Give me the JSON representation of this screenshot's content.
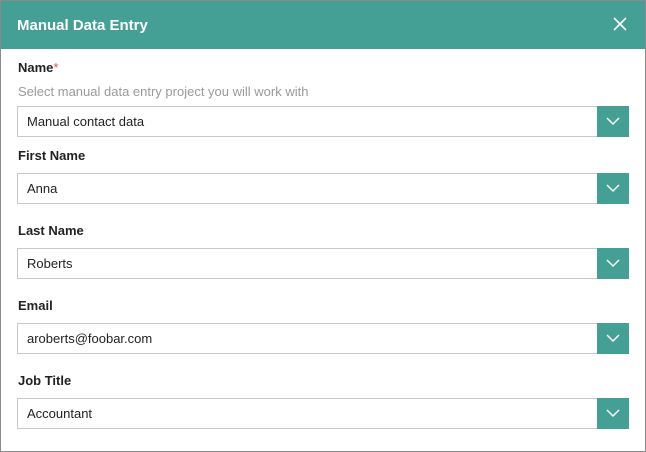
{
  "dialog": {
    "title": "Manual Data Entry",
    "close_icon": "close-icon"
  },
  "fields": {
    "name": {
      "label": "Name",
      "required_marker": "*",
      "hint": "Select manual data entry project you will work with",
      "value": "Manual contact data"
    },
    "first_name": {
      "label": "First Name",
      "value": "Anna"
    },
    "last_name": {
      "label": "Last Name",
      "value": "Roberts"
    },
    "email": {
      "label": "Email",
      "value": "aroberts@foobar.com"
    },
    "job_title": {
      "label": "Job Title",
      "value": "Accountant"
    }
  },
  "colors": {
    "accent": "#44a095",
    "required": "#d9534f",
    "hint_text": "#9a9a9a"
  },
  "icons": {
    "dropdown": "chevron-down-icon",
    "close": "close-icon"
  }
}
